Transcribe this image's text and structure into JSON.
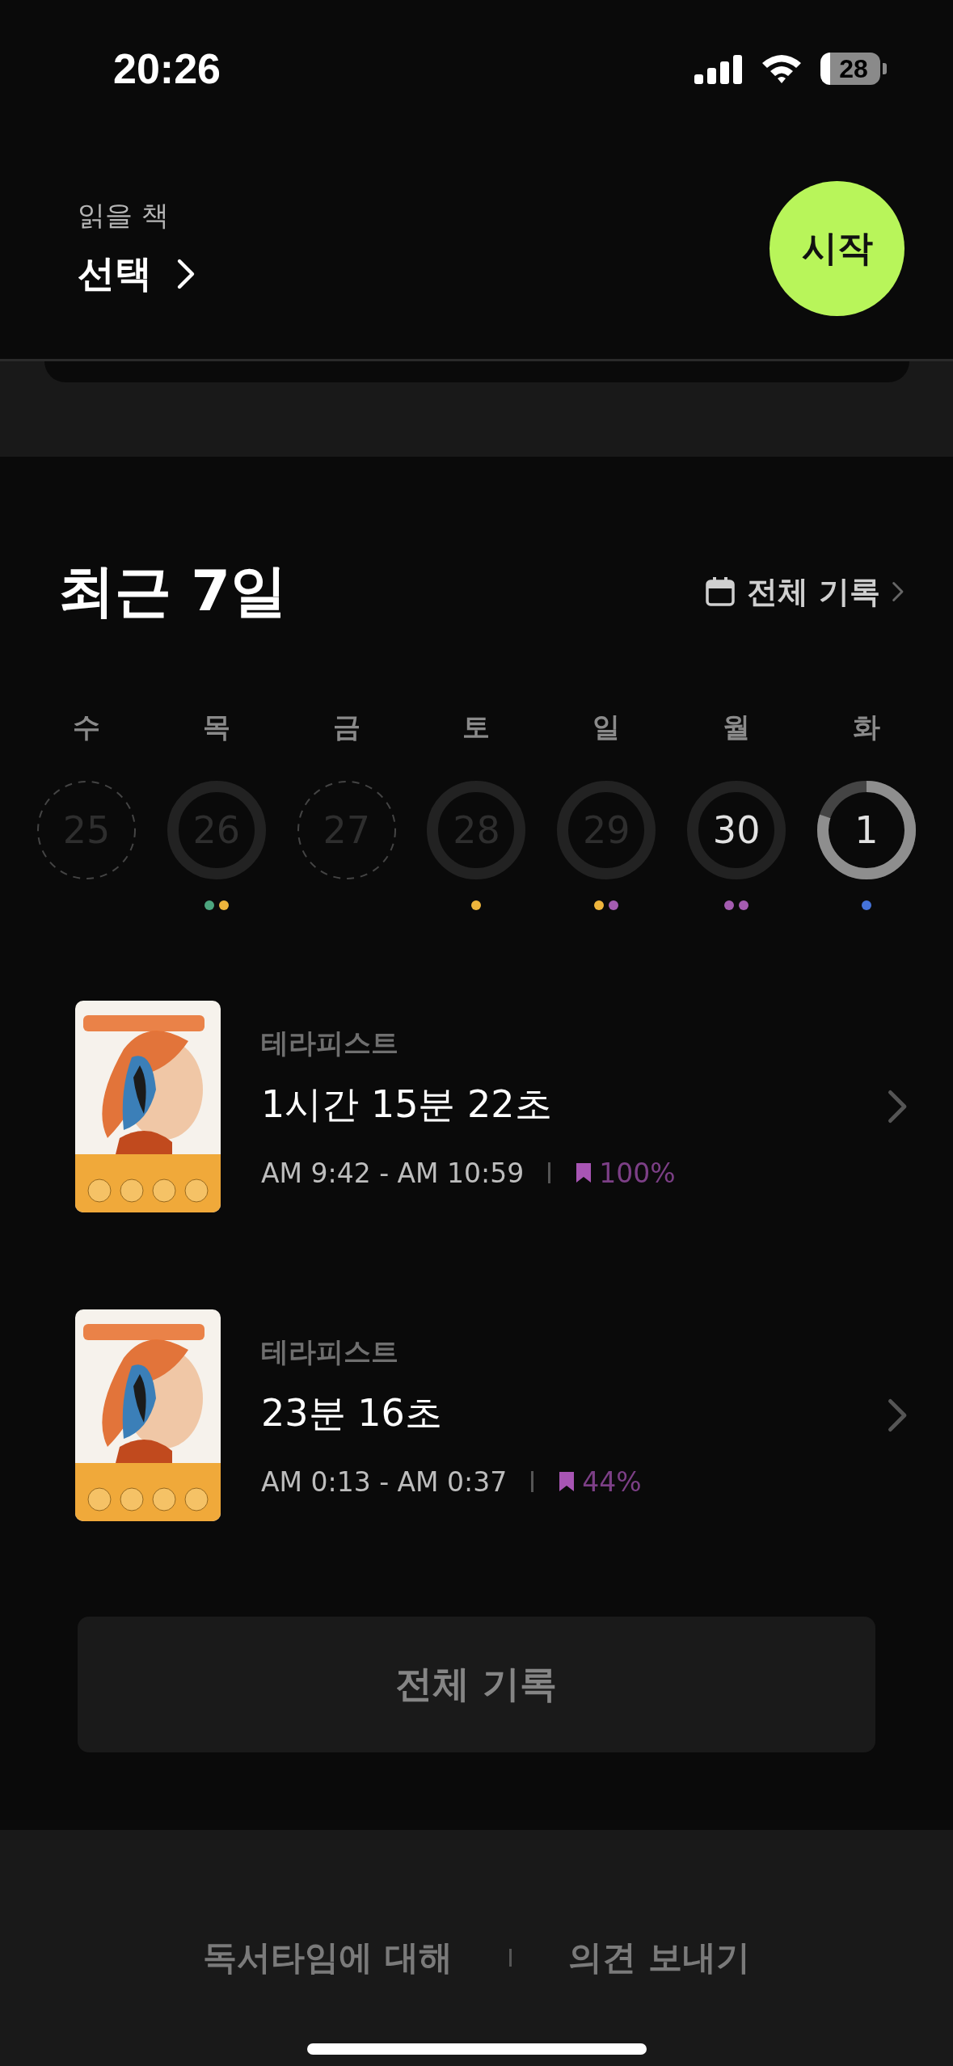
{
  "status_bar": {
    "time": "20:26",
    "battery": "28"
  },
  "header": {
    "label": "읽을 책",
    "value": "선택",
    "start_button": "시작"
  },
  "recent": {
    "title": "최근 7일",
    "all_link": "전체 기록",
    "days": [
      {
        "weekday": "수",
        "date": "25",
        "kind": "empty",
        "active": false
      },
      {
        "weekday": "목",
        "date": "26",
        "kind": "ring",
        "active": false,
        "dots": [
          {
            "color": "#4ca57e"
          },
          {
            "color": "#eeb53c"
          }
        ]
      },
      {
        "weekday": "금",
        "date": "27",
        "kind": "empty",
        "active": false
      },
      {
        "weekday": "토",
        "date": "28",
        "kind": "ring",
        "active": false,
        "dots": [
          {
            "color": "#eeb53c"
          }
        ]
      },
      {
        "weekday": "일",
        "date": "29",
        "kind": "ring",
        "active": false,
        "dots": [
          {
            "color": "#eeb53c"
          },
          {
            "color": "#a45cb0"
          }
        ]
      },
      {
        "weekday": "월",
        "date": "30",
        "kind": "ring",
        "active": true,
        "dots": [
          {
            "color": "#a45cb0"
          },
          {
            "color": "#a45cb0"
          }
        ]
      },
      {
        "weekday": "화",
        "date": "1",
        "kind": "progress",
        "active": true,
        "level": 0.8,
        "dots": [
          {
            "color": "#4573d9"
          }
        ]
      }
    ]
  },
  "sessions": [
    {
      "title": "테라피스트",
      "duration": "1시간 15분 22초",
      "range": "AM 9:42 - AM 10:59",
      "progress": "100%"
    },
    {
      "title": "테라피스트",
      "duration": "23분 16초",
      "range": "AM 0:13 - AM 0:37",
      "progress": "44%"
    }
  ],
  "all_button": "전체 기록",
  "footer": {
    "links": [
      "독서타임에 대해",
      "의견 보내기"
    ]
  }
}
